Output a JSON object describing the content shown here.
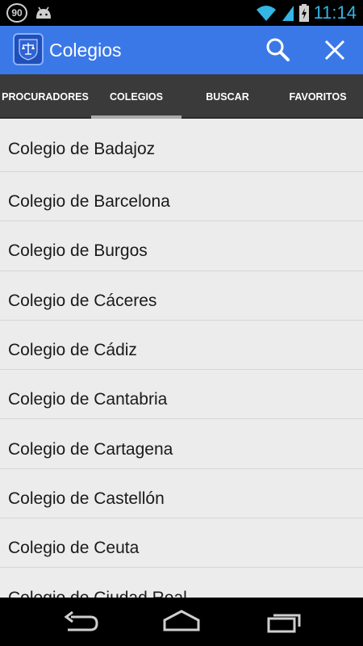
{
  "status": {
    "notification": "90",
    "time": "11:14"
  },
  "action_bar": {
    "title": "Colegios",
    "icons": [
      "app-logo-icon",
      "search-icon",
      "close-icon"
    ]
  },
  "tabs": [
    {
      "label": "PROCURADORES"
    },
    {
      "label": "COLEGIOS"
    },
    {
      "label": "BUSCAR"
    },
    {
      "label": "FAVORITOS"
    }
  ],
  "selected_tab": "COLEGIOS",
  "list": [
    "Colegio de Badajoz",
    "Colegio de Barcelona",
    "Colegio de Burgos",
    "Colegio de Cáceres",
    "Colegio de Cádiz",
    "Colegio de Cantabria",
    "Colegio de Cartagena",
    "Colegio de Castellón",
    "Colegio de Ceuta",
    "Colegio de Ciudad Real"
  ],
  "colors": {
    "action_bar": "#3b78e7",
    "accent": "#33b5e5",
    "tab_bar": "#3a3a3a",
    "list_bg": "#ececec"
  }
}
